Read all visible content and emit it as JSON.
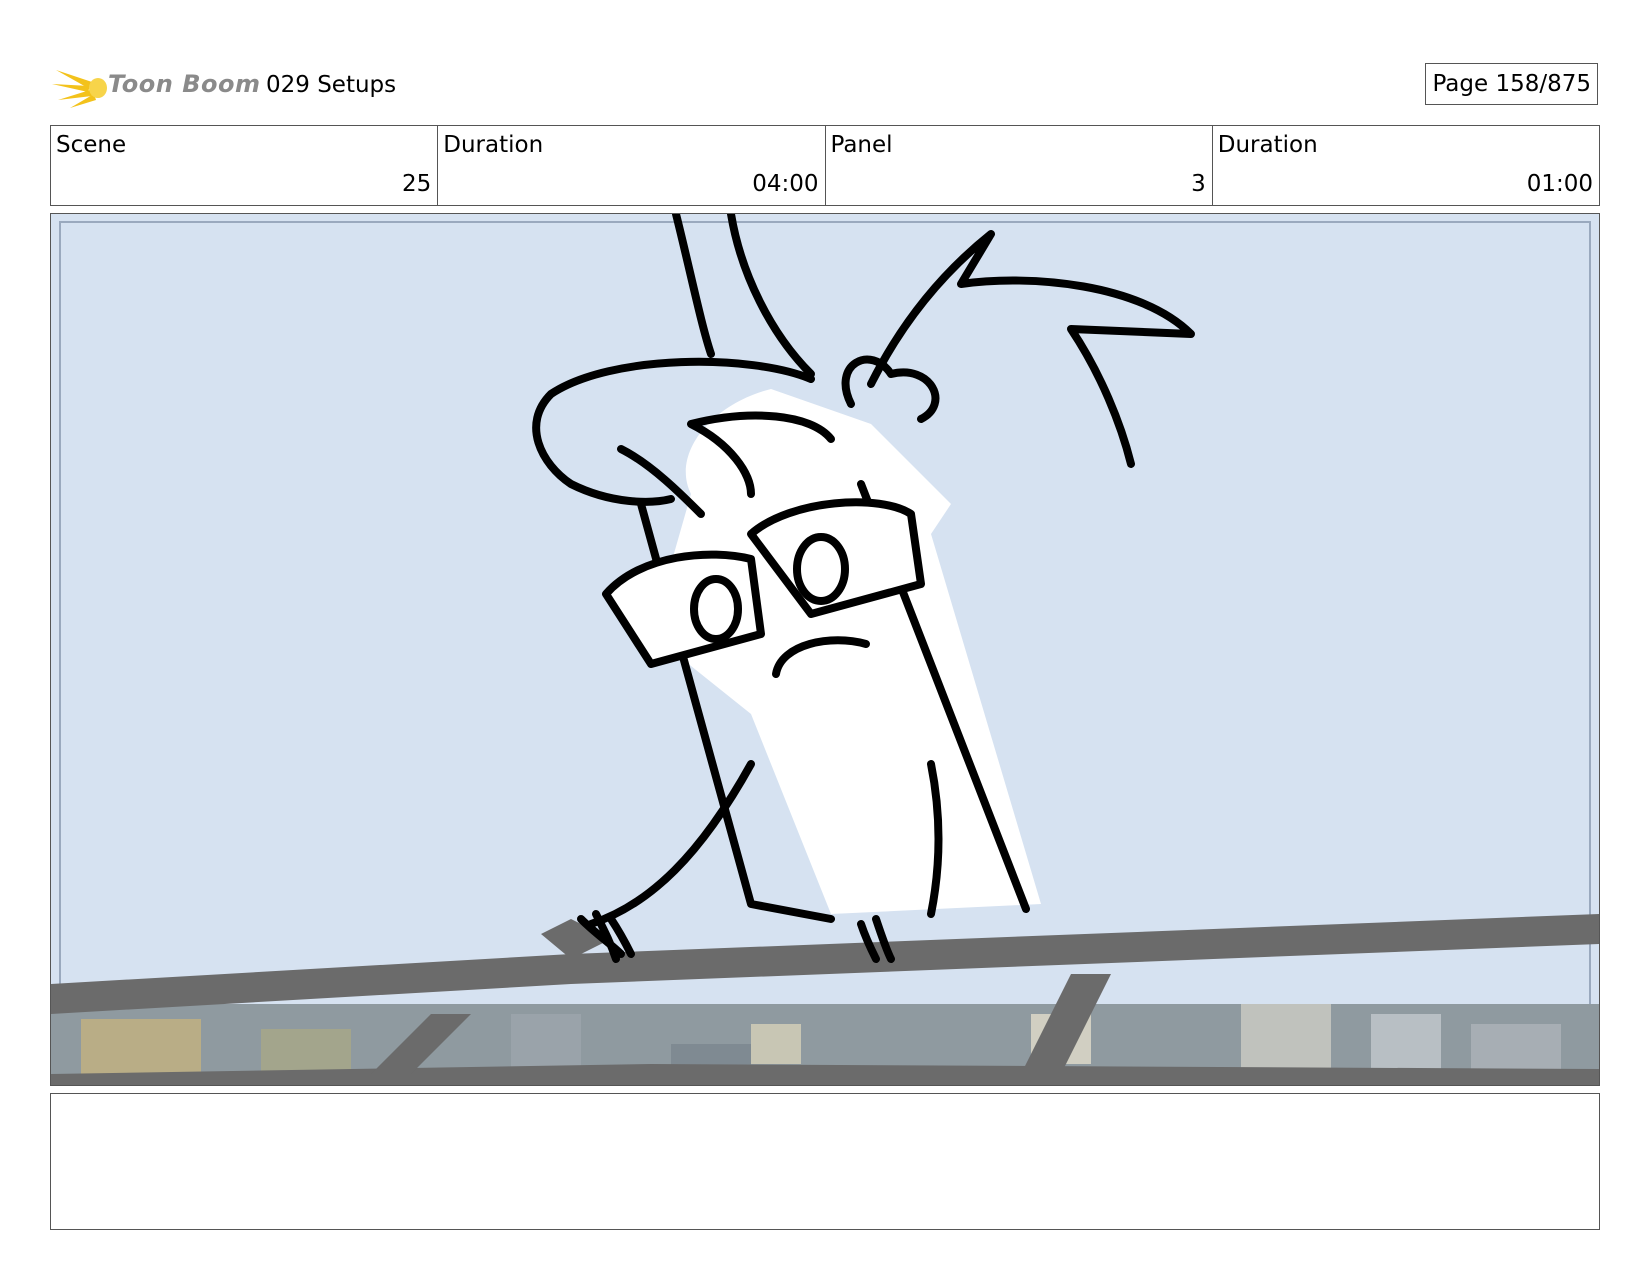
{
  "header": {
    "logo_text": "Toon Boom",
    "title": "029 Setups",
    "page": "Page 158/875"
  },
  "info": {
    "scene_label": "Scene",
    "scene_value": "25",
    "scene_duration_label": "Duration",
    "scene_duration_value": "04:00",
    "panel_label": "Panel",
    "panel_value": "3",
    "panel_duration_label": "Duration",
    "panel_duration_value": "01:00"
  },
  "colors": {
    "sky": "#d6e2f1",
    "rail": "#6b6b6b",
    "logo_yellow": "#f3c21b"
  },
  "notes": {
    "text": ""
  }
}
